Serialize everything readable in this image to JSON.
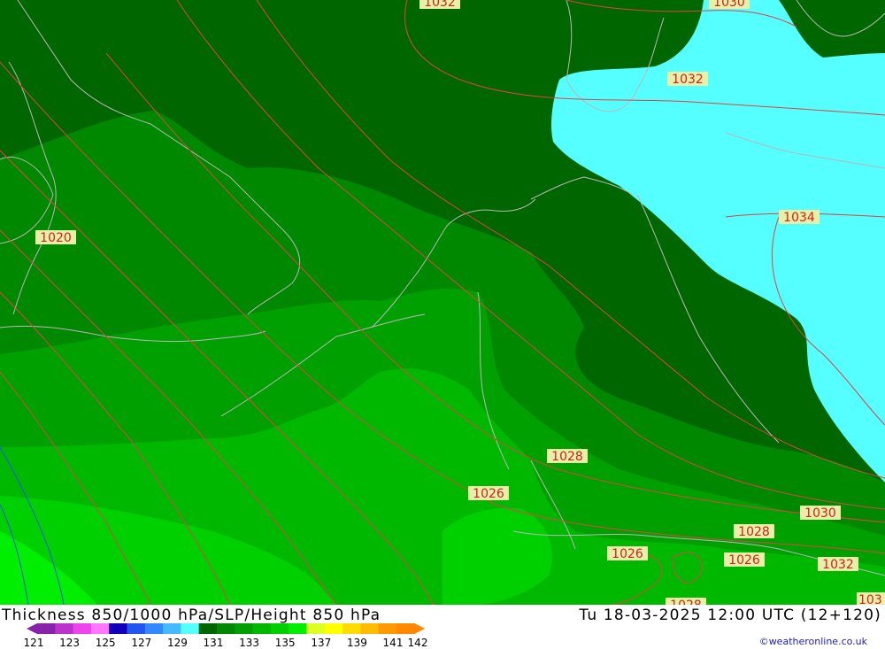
{
  "title": {
    "left": "Thickness 850/1000 hPa/SLP/Height 850 hPa",
    "right": "Tu 18-03-2025 12:00 UTC (12+120)"
  },
  "legend": {
    "ticks": [
      "121",
      "123",
      "125",
      "127",
      "129",
      "131",
      "133",
      "135",
      "137",
      "139",
      "141",
      "142"
    ],
    "colors": [
      "#8822aa",
      "#bb33cc",
      "#ee44ee",
      "#ff77ff",
      "#1100bb",
      "#2255ee",
      "#3388ff",
      "#44bbff",
      "#55ffff",
      "#006600",
      "#008800",
      "#00a000",
      "#00b800",
      "#00d000",
      "#00ee00",
      "#ddff22",
      "#ffff00",
      "#ffdd00",
      "#ffbb00",
      "#ff9900",
      "#ff8800"
    ]
  },
  "pressure_labels": [
    "1032",
    "1030",
    "1032",
    "1020",
    "1034",
    "1028",
    "1026",
    "1030",
    "1028",
    "1026",
    "1026",
    "1032",
    "103",
    "1028"
  ],
  "credit": "©weatheronline.co.uk",
  "colors": {
    "dark_green": "#006600",
    "green_2": "#008800",
    "green_3": "#00a000",
    "green_4": "#00b800",
    "green_5": "#00d000",
    "cyan": "#55ffff",
    "isobar": "#dd4444",
    "coast": "#b8b8b8",
    "label_bg": "#e8f0a8"
  }
}
